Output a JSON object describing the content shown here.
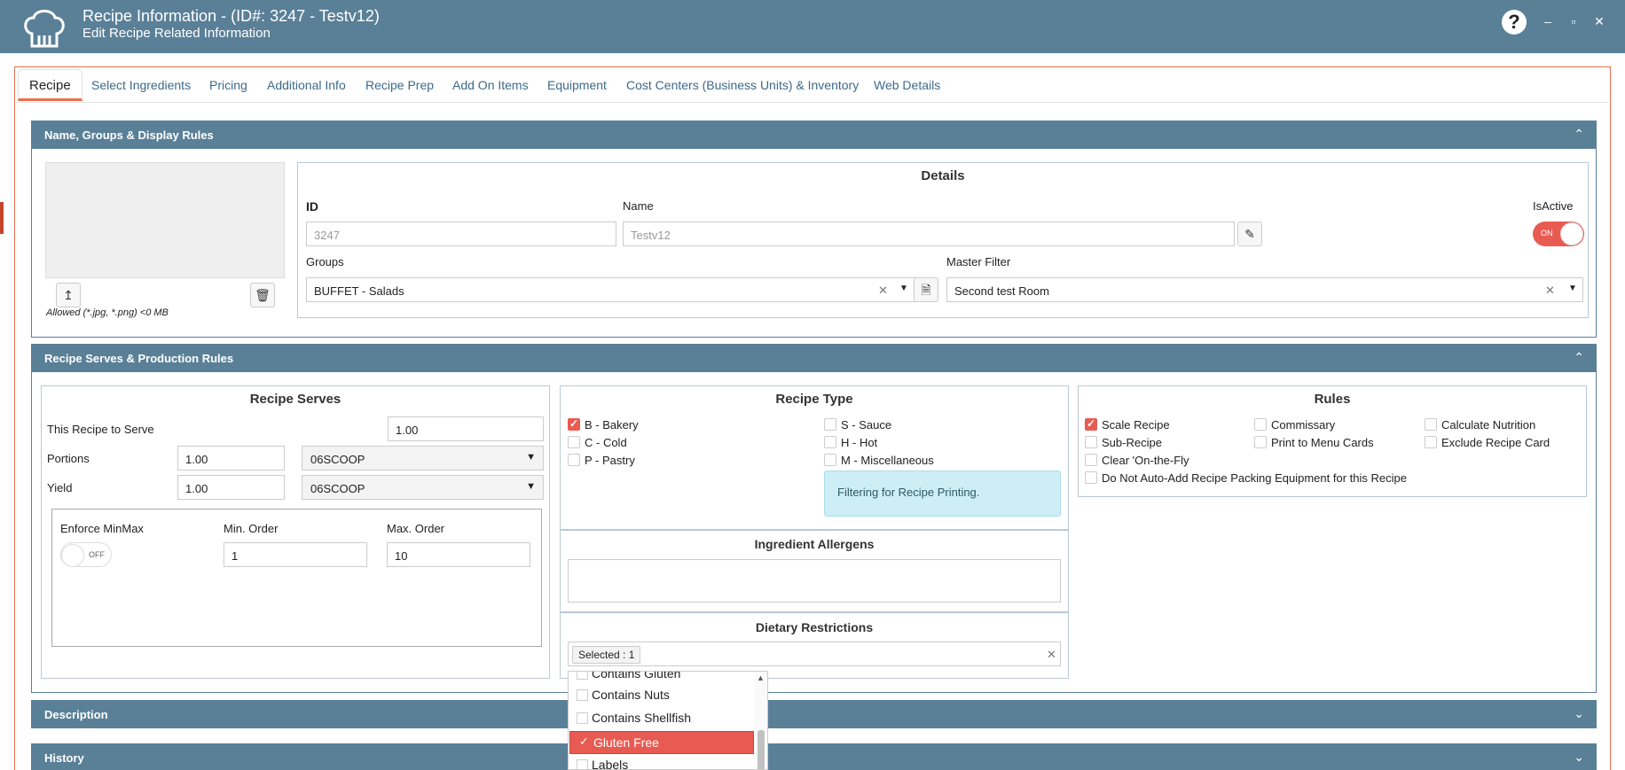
{
  "window": {
    "title": "Recipe Information - (ID#: 3247 - Testv12)",
    "subtitle": "Edit Recipe Related Information",
    "help_label": "?",
    "minimize": "–",
    "maximize": "▫",
    "close": "✕"
  },
  "tabs": [
    {
      "label": "Recipe",
      "active": true
    },
    {
      "label": "Select Ingredients"
    },
    {
      "label": "Pricing"
    },
    {
      "label": "Additional Info"
    },
    {
      "label": "Recipe Prep"
    },
    {
      "label": "Add On Items"
    },
    {
      "label": "Equipment"
    },
    {
      "label": "Cost Centers (Business Units) & Inventory"
    },
    {
      "label": "Web Details"
    }
  ],
  "sections": {
    "name_groups": "Name, Groups & Display Rules",
    "serves": "Recipe Serves & Production Rules",
    "description": "Description",
    "history": "History"
  },
  "image": {
    "note": "Allowed (*.jpg, *.png) <0 MB"
  },
  "details": {
    "title": "Details",
    "id_label": "ID",
    "id_value": "3247",
    "name_label": "Name",
    "name_value": "Testv12",
    "isactive_label": "IsActive",
    "isactive_state": "ON",
    "groups_label": "Groups",
    "groups_value": "BUFFET - Salads",
    "master_filter_label": "Master Filter",
    "master_filter_value": "Second test Room",
    "clear_symbol": "✕",
    "caret_symbol": "▼"
  },
  "serves": {
    "title": "Recipe Serves",
    "this_recipe_label": "This Recipe to Serve",
    "this_recipe_value": "1.00",
    "portions_label": "Portions",
    "portions_value": "1.00",
    "portions_unit": "06SCOOP",
    "yield_label": "Yield",
    "yield_value": "1.00",
    "yield_unit": "06SCOOP",
    "enforce_label": "Enforce MinMax",
    "enforce_state": "OFF",
    "min_label": "Min. Order",
    "min_value": "1",
    "max_label": "Max. Order",
    "max_value": "10"
  },
  "recipe_type": {
    "title": "Recipe Type",
    "options": [
      {
        "label": "B - Bakery",
        "checked": true
      },
      {
        "label": "C - Cold",
        "checked": false
      },
      {
        "label": "P - Pastry",
        "checked": false
      },
      {
        "label": "S - Sauce",
        "checked": false
      },
      {
        "label": "H - Hot",
        "checked": false
      },
      {
        "label": "M - Miscellaneous",
        "checked": false
      }
    ],
    "info": "Filtering for Recipe Printing."
  },
  "rules": {
    "title": "Rules",
    "options": [
      {
        "label": "Scale Recipe",
        "checked": true
      },
      {
        "label": "Sub-Recipe",
        "checked": false
      },
      {
        "label": "Clear 'On-the-Fly",
        "checked": false
      },
      {
        "label": "Do Not Auto-Add Recipe Packing Equipment for this Recipe",
        "checked": false
      },
      {
        "label": "Commissary",
        "checked": false
      },
      {
        "label": "Print to Menu Cards",
        "checked": false
      },
      {
        "label": "Calculate Nutrition",
        "checked": false
      },
      {
        "label": "Exclude Recipe Card",
        "checked": false
      }
    ]
  },
  "allergens": {
    "title": "Ingredient Allergens"
  },
  "dietary": {
    "title": "Dietary Restrictions",
    "selected_badge": "Selected : 1",
    "items": [
      {
        "label": "Contains Gluten",
        "selected": false
      },
      {
        "label": "Contains Nuts",
        "selected": false
      },
      {
        "label": "Contains Shellfish",
        "selected": false
      },
      {
        "label": "Gluten Free",
        "selected": true
      },
      {
        "label": "Labels",
        "selected": false
      }
    ]
  },
  "colors": {
    "header": "#5a8098",
    "accent": "#e85b52",
    "tab_text": "#3d6a8a"
  }
}
